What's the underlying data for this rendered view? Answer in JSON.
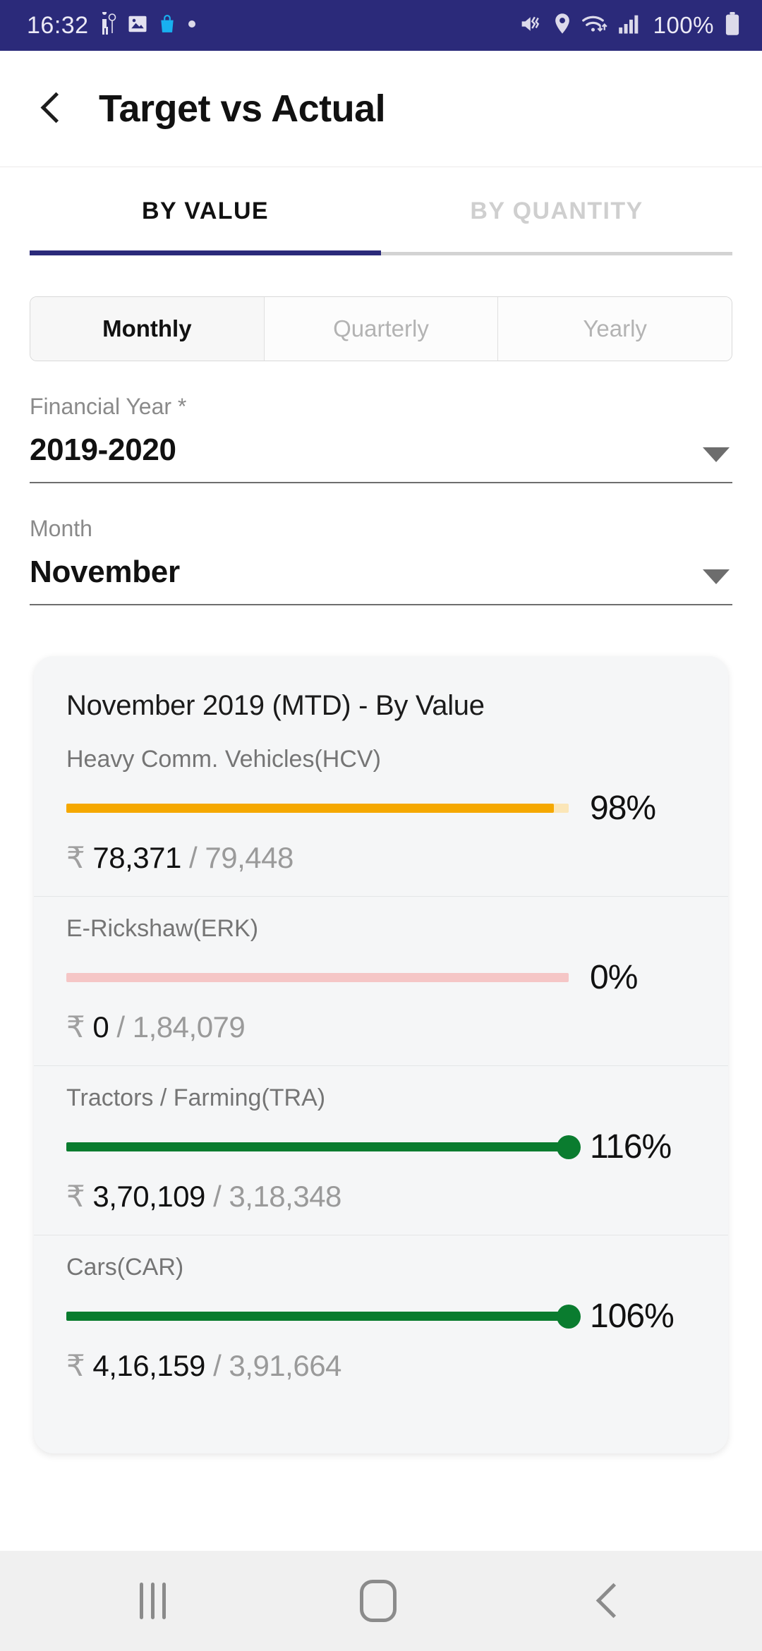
{
  "status_bar": {
    "time": "16:32",
    "battery_percent": "100%",
    "left_icons": [
      "navigation-arrow-icon",
      "image-icon",
      "shopping-bag-icon",
      "dot-icon"
    ],
    "right_icons": [
      "mute-vibrate-icon",
      "location-pin-icon",
      "wifi-icon",
      "signal-bars-icon",
      "battery-icon"
    ],
    "background_color": "#2b2a7a"
  },
  "app_bar": {
    "title": "Target vs Actual",
    "back_icon": "back-chevron-icon"
  },
  "tabs": [
    {
      "label": "BY VALUE",
      "active": true
    },
    {
      "label": "BY QUANTITY",
      "active": false
    }
  ],
  "period_segments": [
    {
      "label": "Monthly",
      "active": true
    },
    {
      "label": "Quarterly",
      "active": false
    },
    {
      "label": "Yearly",
      "active": false
    }
  ],
  "filters": [
    {
      "label": "Financial Year *",
      "value": "2019-2020",
      "caret": "chevron-down-icon"
    },
    {
      "label": "Month",
      "value": "November",
      "caret": "chevron-down-icon"
    }
  ],
  "card": {
    "title": "November 2019 (MTD) - By Value",
    "currency_symbol": "₹"
  },
  "chart_data": {
    "type": "bar",
    "title": "November 2019 (MTD) - By Value",
    "orientation": "horizontal",
    "unit": "INR",
    "categories": [
      "Heavy Comm. Vehicles(HCV)",
      "E-Rickshaw(ERK)",
      "Tractors / Farming(TRA)",
      "Cars(CAR)"
    ],
    "series": [
      {
        "name": "Actual",
        "values": [
          78371,
          0,
          370109,
          416159
        ]
      },
      {
        "name": "Target",
        "values": [
          79448,
          184079,
          318348,
          391664
        ]
      }
    ],
    "rows": [
      {
        "name": "Heavy Comm. Vehicles(HCV)",
        "actual_display": "78,371",
        "target_display": "79,448",
        "percent_label": "98%",
        "percent_value": 98,
        "fill_pct": 97,
        "bar_style": "orange",
        "bar_color": "#f5a800",
        "track_color": "#fbe6b8",
        "knob": false
      },
      {
        "name": "E-Rickshaw(ERK)",
        "actual_display": "0",
        "target_display": "1,84,079",
        "percent_label": "0%",
        "percent_value": 0,
        "fill_pct": 0,
        "bar_style": "pink",
        "bar_color": "#f5c6c6",
        "track_color": "#f5c6c6",
        "knob": false
      },
      {
        "name": "Tractors / Farming(TRA)",
        "actual_display": "3,70,109",
        "target_display": "3,18,348",
        "percent_label": "116%",
        "percent_value": 116,
        "fill_pct": 100,
        "bar_style": "green",
        "bar_color": "#0a7c2f",
        "track_color": "transparent",
        "knob": true
      },
      {
        "name": "Cars(CAR)",
        "actual_display": "4,16,159",
        "target_display": "3,91,664",
        "percent_label": "106%",
        "percent_value": 106,
        "fill_pct": 100,
        "bar_style": "green",
        "bar_color": "#0a7c2f",
        "track_color": "transparent",
        "knob": true
      }
    ],
    "legend": [],
    "grid": false
  },
  "nav_bar": {
    "items": [
      "recents-icon",
      "home-icon",
      "back-icon"
    ]
  },
  "colors": {
    "status_bar": "#2b2a7a",
    "accent": "#2b2a7a",
    "orange": "#f5a800",
    "green": "#0a7c2f",
    "pink": "#f5c6c6",
    "card_bg": "#f5f6f7"
  }
}
